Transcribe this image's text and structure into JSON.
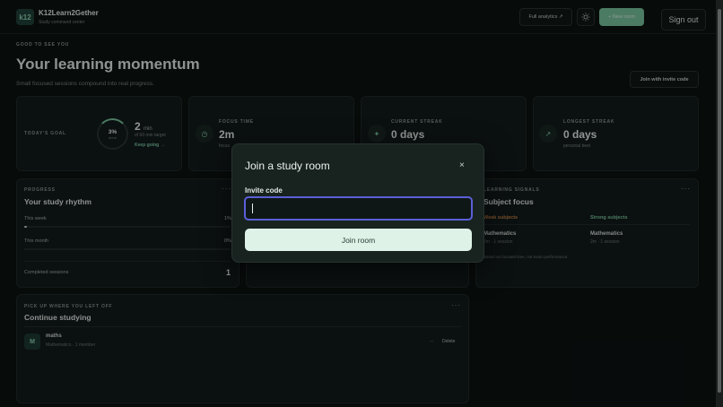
{
  "header": {
    "logo_text": "k12",
    "app_name": "K12Learn2Gether",
    "tagline": "Study command center",
    "analytics_label": "Full analytics ↗",
    "theme_icon": "sun-icon",
    "new_room_label": "+ New room",
    "sign_out_label": "Sign out"
  },
  "hero": {
    "eyebrow": "GOOD TO SEE YOU",
    "title": "Your learning momentum",
    "subtitle": "Small focused sessions compound into real progress.",
    "invite_button": "Join with invite code"
  },
  "stats": {
    "goal": {
      "label": "TODAY'S GOAL",
      "percent_text": "3%",
      "done_label": "done",
      "progress_fraction": 0.03,
      "value": "2",
      "unit": "min",
      "target": "of 60 min target",
      "cta": "Keep going →"
    },
    "focus": {
      "label": "FOCUS TIME",
      "value": "2m",
      "sub": "focus"
    },
    "current_streak": {
      "label": "CURRENT STREAK",
      "value": "0 days"
    },
    "longest_streak": {
      "label": "LONGEST STREAK",
      "value": "0 days",
      "sub": "personal best"
    }
  },
  "progress": {
    "eyebrow": "PROGRESS",
    "title": "Your study rhythm",
    "rows": [
      {
        "label": "This week",
        "value": "1%",
        "fraction": 0.01
      },
      {
        "label": "This month",
        "value": "0%",
        "fraction": 0.0
      }
    ],
    "completed_label": "Completed sessions",
    "completed_value": "1"
  },
  "signals": {
    "eyebrow": "LEARNING SIGNALS",
    "title": "Subject focus",
    "weak_head": "Weak subjects",
    "strong_head": "Strong subjects",
    "weak_subject": "Mathematics",
    "weak_meta": "2m · 1 session",
    "strong_subject": "Mathematics",
    "strong_meta": "2m · 1 session",
    "note": "Based on focused time, not exam performance.",
    "colors": {
      "weak": "#c7844a",
      "strong": "#79c7a1"
    }
  },
  "continue": {
    "eyebrow": "PICK UP WHERE YOU LEFT OFF",
    "title": "Continue studying",
    "room_initial": "M",
    "room_name": "maths",
    "room_meta": "Mathematics · 1 member",
    "open_icon": "arrow-right-icon",
    "delete_label": "Delete"
  },
  "modal": {
    "title": "Join a study room",
    "close_glyph": "×",
    "field_label": "Invite code",
    "field_value": "",
    "field_placeholder": "",
    "join_label": "Join room"
  },
  "colors": {
    "accent": "#79c7a1",
    "background": "#0c1211",
    "focus_ring": "#5b5fd8"
  }
}
